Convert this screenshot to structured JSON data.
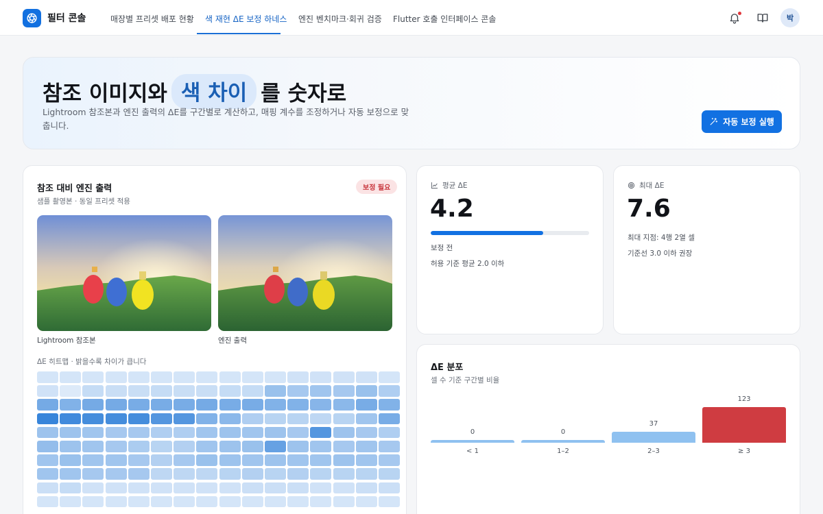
{
  "app": {
    "brand": "필터 콘솔"
  },
  "nav": {
    "tabs": [
      {
        "label": "매장별 프리셋 배포 현황"
      },
      {
        "label": "색 재현 ΔE 보정 하네스"
      },
      {
        "label": "엔진 벤치마크·회귀 검증"
      },
      {
        "label": "Flutter 호출 인터페이스 콘솔"
      }
    ],
    "active_index": 1
  },
  "user": {
    "initial": "박"
  },
  "hero": {
    "title_before": "참조 이미지와",
    "title_highlight": "색 차이",
    "title_after": "를 숫자로",
    "description": "Lightroom 참조본과 엔진 출력의 ΔE를 구간별로 계산하고, 매핑 계수를 조정하거나 자동 보정으로 맞춥니다.",
    "cta_label": "자동 보정 실행"
  },
  "compare": {
    "title": "참조 대비 엔진 출력",
    "subtitle": "샘플 촬영본 · 동일 프리셋 적용",
    "badge": "보정 필요",
    "reference_caption": "Lightroom 참조본",
    "engine_caption": "엔진 출력",
    "heatmap_label": "ΔE 히트맵 · 밝을수록 차이가 큽니다",
    "heatmap": [
      [
        0.1,
        0.1,
        0.1,
        0.1,
        0.1,
        0.1,
        0.1,
        0.1,
        0.1,
        0.1,
        0.1,
        0.12,
        0.12,
        0.12,
        0.12,
        0.1
      ],
      [
        0.12,
        0.05,
        0.18,
        0.16,
        0.16,
        0.18,
        0.16,
        0.16,
        0.18,
        0.18,
        0.42,
        0.35,
        0.38,
        0.35,
        0.42,
        0.3
      ],
      [
        0.62,
        0.55,
        0.62,
        0.62,
        0.6,
        0.6,
        0.6,
        0.62,
        0.6,
        0.6,
        0.55,
        0.55,
        0.52,
        0.5,
        0.6,
        0.55
      ],
      [
        0.95,
        0.9,
        0.88,
        0.88,
        0.88,
        0.8,
        0.8,
        0.55,
        0.5,
        0.3,
        0.25,
        0.25,
        0.22,
        0.25,
        0.38,
        0.6
      ],
      [
        0.4,
        0.4,
        0.38,
        0.35,
        0.35,
        0.3,
        0.3,
        0.38,
        0.4,
        0.38,
        0.4,
        0.35,
        0.8,
        0.4,
        0.35,
        0.3
      ],
      [
        0.45,
        0.4,
        0.38,
        0.35,
        0.32,
        0.25,
        0.28,
        0.38,
        0.4,
        0.42,
        0.7,
        0.4,
        0.38,
        0.35,
        0.38,
        0.35
      ],
      [
        0.38,
        0.42,
        0.38,
        0.38,
        0.35,
        0.28,
        0.35,
        0.42,
        0.4,
        0.38,
        0.4,
        0.38,
        0.38,
        0.4,
        0.38,
        0.35
      ],
      [
        0.38,
        0.38,
        0.35,
        0.35,
        0.35,
        0.22,
        0.22,
        0.22,
        0.25,
        0.28,
        0.25,
        0.28,
        0.25,
        0.25,
        0.25,
        0.25
      ],
      [
        0.15,
        0.18,
        0.12,
        0.12,
        0.12,
        0.12,
        0.12,
        0.12,
        0.12,
        0.15,
        0.15,
        0.15,
        0.12,
        0.12,
        0.15,
        0.15
      ],
      [
        0.1,
        0.1,
        0.1,
        0.1,
        0.1,
        0.1,
        0.1,
        0.1,
        0.1,
        0.1,
        0.1,
        0.1,
        0.1,
        0.1,
        0.1,
        0.1
      ]
    ]
  },
  "avg": {
    "label": "평균 ΔE",
    "value": "4.2",
    "meter_fraction": 0.71,
    "state": "보정 전",
    "threshold": "허용 기준 평균 2.0 이하"
  },
  "max": {
    "label": "최대 ΔE",
    "value": "7.6",
    "location": "최대 지점: 4행 2열 셀",
    "recommend": "기준선 3.0 이하 권장"
  },
  "distribution": {
    "title": "ΔE 분포",
    "subtitle": "셀 수 기준 구간별 비율"
  },
  "chart_data": {
    "type": "bar",
    "title": "ΔE 분포",
    "categories": [
      "< 1",
      "1–2",
      "2–3",
      "≥ 3"
    ],
    "values": [
      0,
      0,
      37,
      123
    ],
    "ylim": [
      0,
      123
    ],
    "colors": [
      "#8fc1f0",
      "#8fc1f0",
      "#8fc1f0",
      "#cf3c41"
    ]
  },
  "colors": {
    "accent": "#1271e2",
    "danger": "#cf3c41",
    "heat_low": "#e6f0fb",
    "heat_high": "#2f7fd8"
  }
}
